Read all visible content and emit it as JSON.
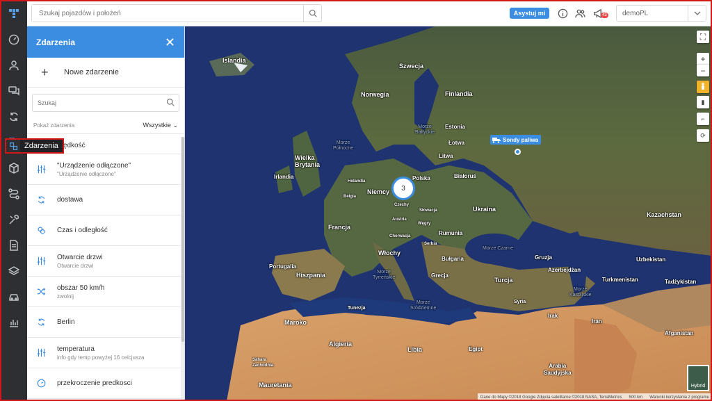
{
  "topbar": {
    "search_placeholder": "Szukaj pojazdów i położeń",
    "assist_label": "Asystuj mi",
    "notification_count": "43",
    "account": "demoPL"
  },
  "rail": {
    "tooltip": "Zdarzenia",
    "icons": [
      "dashboard-icon",
      "user-icon",
      "chat-icon",
      "refresh-icon",
      "events-icon",
      "box-icon",
      "route-icon",
      "tools-icon",
      "document-icon",
      "layers-icon",
      "car-icon",
      "chart-icon"
    ]
  },
  "panel": {
    "title": "Zdarzenia",
    "new_event": "Nowe zdarzenie",
    "search_placeholder": "Szukaj",
    "filter_label": "Pokaż zdarzenia",
    "filter_value": "Wszystkie",
    "events": [
      {
        "name": "prędkość",
        "sub": "",
        "icon": "speed-icon"
      },
      {
        "name": "\"Urządzenie odłączone\"",
        "sub": "\"Urządzenie odłączone\"",
        "icon": "sliders-icon"
      },
      {
        "name": "dostawa",
        "sub": "",
        "icon": "cycle-icon"
      },
      {
        "name": "Czas i odległość",
        "sub": "",
        "icon": "pin-group-icon"
      },
      {
        "name": "Otwarcie drzwi",
        "sub": "Otwarcie drzwi",
        "icon": "sliders-icon"
      },
      {
        "name": "obszar 50 km/h",
        "sub": "zwolnij",
        "icon": "shuffle-icon"
      },
      {
        "name": "Berlin",
        "sub": "",
        "icon": "cycle-icon"
      },
      {
        "name": "temperatura",
        "sub": "info gdy temp powyżej 16 celcjusza",
        "icon": "sliders-icon"
      },
      {
        "name": "przekroczenie predkosci",
        "sub": "",
        "icon": "speed-icon"
      }
    ]
  },
  "map": {
    "cluster_count": "3",
    "vehicle_label": "Sondy paliwa",
    "hybrid_label": "Hybrid",
    "attribution": "Dane do Mapy ©2018 Google Zdjęcia satelitarne ©2018 NASA, TerraMetrics",
    "scale": "500 km",
    "terms": "Warunki korzystania z programu",
    "labels": {
      "islandia": "Islandia",
      "szwecja": "Szwecja",
      "finlandia": "Finlandia",
      "norwegia": "Norwegia",
      "estonia": "Estonia",
      "lotwa": "Łotwa",
      "litwa": "Litwa",
      "wielka_brytania": "Wielka\nBrytania",
      "irlandia": "Irlandia",
      "bialorus": "Białoruś",
      "polska": "Polska",
      "niemcy": "Niemcy",
      "holandia": "Holandia",
      "belgia": "Belgia",
      "czechy": "Czechy",
      "slowacja": "Słowacja",
      "austria": "Austria",
      "wegry": "Węgry",
      "ukraina": "Ukraina",
      "francja": "Francja",
      "rumunia": "Rumunia",
      "chorwacja": "Chorwacja",
      "serbia": "Serbia",
      "wlochy": "Włochy",
      "bulgaria": "Bułgaria",
      "portugalia": "Portugalia",
      "hiszpania": "Hiszpania",
      "grecja": "Grecja",
      "turcja": "Turcja",
      "kazachstan": "Kazachstan",
      "gruzja": "Gruzja",
      "azerbejdzan": "Azerbejdżan",
      "uzbekistan": "Uzbekistan",
      "turkmenistan": "Turkmenistan",
      "tadzykistan": "Tadżykistan",
      "tunezja": "Tunezja",
      "maroko": "Maroko",
      "algieria": "Algieria",
      "libia": "Libia",
      "egipt": "Egipt",
      "iran": "Iran",
      "irak": "Irak",
      "syria": "Syria",
      "afganistan": "Afganistan",
      "arabia": "Arabia\nSaudyjska",
      "mauretania": "Mauretania",
      "sahara": "Sahara\nZachodnia",
      "morze_polnocne": "Morze\nPółnocne",
      "morze_baltyckie": "Morze\nBałtyckie",
      "morze_czarne": "Morze Czarne",
      "morze_tyrrenskie": "Morze\nTyrreńskie",
      "morze_srodziemne": "Morze\nŚródziemne",
      "morze_kaspijskie": "Morze\nKaspijskie"
    }
  }
}
